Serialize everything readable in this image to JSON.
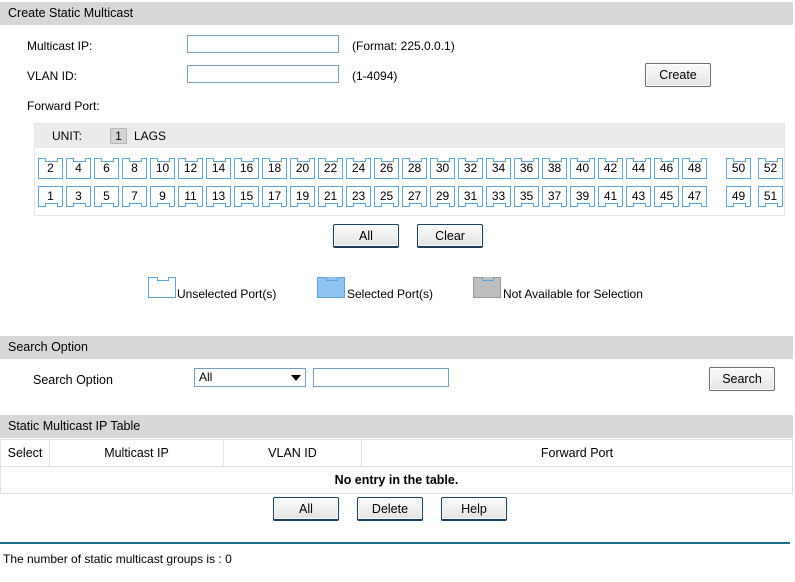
{
  "create_section": {
    "title": "Create Static Multicast",
    "multicast_ip_label": "Multicast IP:",
    "multicast_ip_value": "",
    "multicast_ip_hint": "(Format: 225.0.0.1)",
    "vlan_id_label": "VLAN ID:",
    "vlan_id_value": "",
    "vlan_id_hint": "(1-4094)",
    "create_label": "Create",
    "forward_port_label": "Forward Port:"
  },
  "port_panel": {
    "unit_label": "UNIT:",
    "unit_number": "1",
    "lags_label": "LAGS",
    "top_ports": [
      "2",
      "4",
      "6",
      "8",
      "10",
      "12",
      "14",
      "16",
      "18",
      "20",
      "22",
      "24",
      "26",
      "28",
      "30",
      "32",
      "34",
      "36",
      "38",
      "40",
      "42",
      "44",
      "46",
      "48"
    ],
    "top_extra": [
      "50",
      "52"
    ],
    "bottom_ports": [
      "1",
      "3",
      "5",
      "7",
      "9",
      "11",
      "13",
      "15",
      "17",
      "19",
      "21",
      "23",
      "25",
      "27",
      "29",
      "31",
      "33",
      "35",
      "37",
      "39",
      "41",
      "43",
      "45",
      "47"
    ],
    "bottom_extra": [
      "49",
      "51"
    ],
    "all_label": "All",
    "clear_label": "Clear"
  },
  "legend": {
    "unselected": "Unselected Port(s)",
    "selected": "Selected Port(s)",
    "not_available": "Not Available for Selection",
    "colors": {
      "unselected": "#ffffff",
      "selected": "#8fc4f0",
      "not_available": "#bdbdbd",
      "port_border": "#63a3d6"
    }
  },
  "search_section": {
    "title": "Search Option",
    "label": "Search Option",
    "select_value": "All",
    "input_value": "",
    "search_label": "Search"
  },
  "table_section": {
    "title": "Static Multicast IP Table",
    "columns": [
      "Select",
      "Multicast IP",
      "VLAN ID",
      "Forward Port"
    ],
    "empty_message": "No entry in the table.",
    "all_label": "All",
    "delete_label": "Delete",
    "help_label": "Help"
  },
  "footer": {
    "text": "The number of static multicast groups is : 0"
  }
}
